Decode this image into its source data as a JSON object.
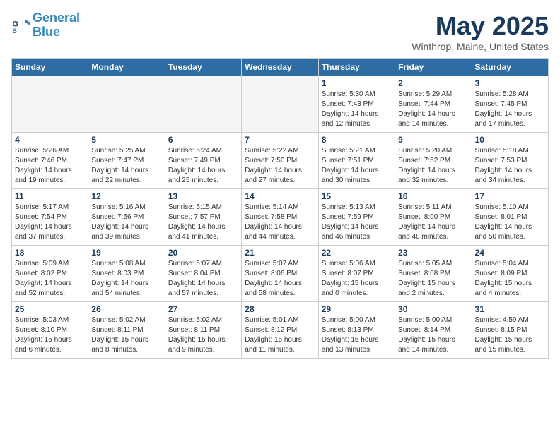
{
  "header": {
    "logo_line1": "General",
    "logo_line2": "Blue",
    "title": "May 2025",
    "subtitle": "Winthrop, Maine, United States"
  },
  "days_of_week": [
    "Sunday",
    "Monday",
    "Tuesday",
    "Wednesday",
    "Thursday",
    "Friday",
    "Saturday"
  ],
  "weeks": [
    [
      {
        "day": "",
        "info": ""
      },
      {
        "day": "",
        "info": ""
      },
      {
        "day": "",
        "info": ""
      },
      {
        "day": "",
        "info": ""
      },
      {
        "day": "1",
        "info": "Sunrise: 5:30 AM\nSunset: 7:43 PM\nDaylight: 14 hours\nand 12 minutes."
      },
      {
        "day": "2",
        "info": "Sunrise: 5:29 AM\nSunset: 7:44 PM\nDaylight: 14 hours\nand 14 minutes."
      },
      {
        "day": "3",
        "info": "Sunrise: 5:28 AM\nSunset: 7:45 PM\nDaylight: 14 hours\nand 17 minutes."
      }
    ],
    [
      {
        "day": "4",
        "info": "Sunrise: 5:26 AM\nSunset: 7:46 PM\nDaylight: 14 hours\nand 19 minutes."
      },
      {
        "day": "5",
        "info": "Sunrise: 5:25 AM\nSunset: 7:47 PM\nDaylight: 14 hours\nand 22 minutes."
      },
      {
        "day": "6",
        "info": "Sunrise: 5:24 AM\nSunset: 7:49 PM\nDaylight: 14 hours\nand 25 minutes."
      },
      {
        "day": "7",
        "info": "Sunrise: 5:22 AM\nSunset: 7:50 PM\nDaylight: 14 hours\nand 27 minutes."
      },
      {
        "day": "8",
        "info": "Sunrise: 5:21 AM\nSunset: 7:51 PM\nDaylight: 14 hours\nand 30 minutes."
      },
      {
        "day": "9",
        "info": "Sunrise: 5:20 AM\nSunset: 7:52 PM\nDaylight: 14 hours\nand 32 minutes."
      },
      {
        "day": "10",
        "info": "Sunrise: 5:18 AM\nSunset: 7:53 PM\nDaylight: 14 hours\nand 34 minutes."
      }
    ],
    [
      {
        "day": "11",
        "info": "Sunrise: 5:17 AM\nSunset: 7:54 PM\nDaylight: 14 hours\nand 37 minutes."
      },
      {
        "day": "12",
        "info": "Sunrise: 5:16 AM\nSunset: 7:56 PM\nDaylight: 14 hours\nand 39 minutes."
      },
      {
        "day": "13",
        "info": "Sunrise: 5:15 AM\nSunset: 7:57 PM\nDaylight: 14 hours\nand 41 minutes."
      },
      {
        "day": "14",
        "info": "Sunrise: 5:14 AM\nSunset: 7:58 PM\nDaylight: 14 hours\nand 44 minutes."
      },
      {
        "day": "15",
        "info": "Sunrise: 5:13 AM\nSunset: 7:59 PM\nDaylight: 14 hours\nand 46 minutes."
      },
      {
        "day": "16",
        "info": "Sunrise: 5:11 AM\nSunset: 8:00 PM\nDaylight: 14 hours\nand 48 minutes."
      },
      {
        "day": "17",
        "info": "Sunrise: 5:10 AM\nSunset: 8:01 PM\nDaylight: 14 hours\nand 50 minutes."
      }
    ],
    [
      {
        "day": "18",
        "info": "Sunrise: 5:09 AM\nSunset: 8:02 PM\nDaylight: 14 hours\nand 52 minutes."
      },
      {
        "day": "19",
        "info": "Sunrise: 5:08 AM\nSunset: 8:03 PM\nDaylight: 14 hours\nand 54 minutes."
      },
      {
        "day": "20",
        "info": "Sunrise: 5:07 AM\nSunset: 8:04 PM\nDaylight: 14 hours\nand 57 minutes."
      },
      {
        "day": "21",
        "info": "Sunrise: 5:07 AM\nSunset: 8:06 PM\nDaylight: 14 hours\nand 58 minutes."
      },
      {
        "day": "22",
        "info": "Sunrise: 5:06 AM\nSunset: 8:07 PM\nDaylight: 15 hours\nand 0 minutes."
      },
      {
        "day": "23",
        "info": "Sunrise: 5:05 AM\nSunset: 8:08 PM\nDaylight: 15 hours\nand 2 minutes."
      },
      {
        "day": "24",
        "info": "Sunrise: 5:04 AM\nSunset: 8:09 PM\nDaylight: 15 hours\nand 4 minutes."
      }
    ],
    [
      {
        "day": "25",
        "info": "Sunrise: 5:03 AM\nSunset: 8:10 PM\nDaylight: 15 hours\nand 6 minutes."
      },
      {
        "day": "26",
        "info": "Sunrise: 5:02 AM\nSunset: 8:11 PM\nDaylight: 15 hours\nand 8 minutes."
      },
      {
        "day": "27",
        "info": "Sunrise: 5:02 AM\nSunset: 8:11 PM\nDaylight: 15 hours\nand 9 minutes."
      },
      {
        "day": "28",
        "info": "Sunrise: 5:01 AM\nSunset: 8:12 PM\nDaylight: 15 hours\nand 11 minutes."
      },
      {
        "day": "29",
        "info": "Sunrise: 5:00 AM\nSunset: 8:13 PM\nDaylight: 15 hours\nand 13 minutes."
      },
      {
        "day": "30",
        "info": "Sunrise: 5:00 AM\nSunset: 8:14 PM\nDaylight: 15 hours\nand 14 minutes."
      },
      {
        "day": "31",
        "info": "Sunrise: 4:59 AM\nSunset: 8:15 PM\nDaylight: 15 hours\nand 15 minutes."
      }
    ]
  ]
}
